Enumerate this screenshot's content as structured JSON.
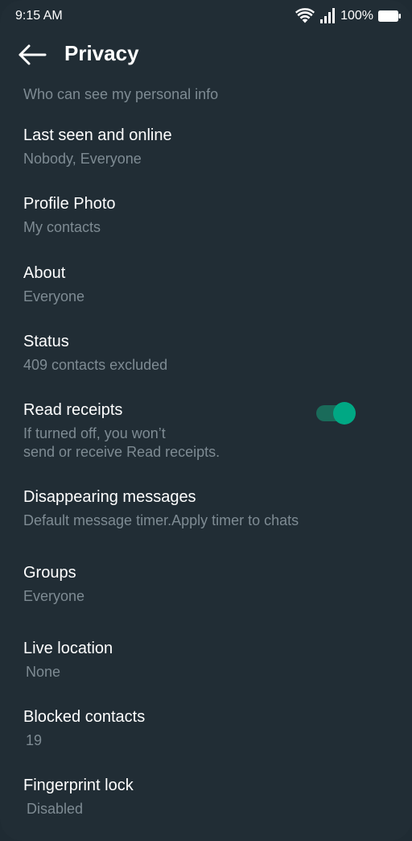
{
  "status_bar": {
    "time": "9:15 AM",
    "battery": "100%",
    "icons": [
      "wifi-icon",
      "signal-icon",
      "battery-icon"
    ]
  },
  "app_bar": {
    "title": "Privacy",
    "back_icon": "arrow-left-icon"
  },
  "section_header": "Who can see my personal info",
  "settings": [
    {
      "title": "Last seen and online",
      "subtitle": "Nobody, Everyone"
    },
    {
      "title": "Profile Photo",
      "subtitle": "My contacts"
    },
    {
      "title": "About",
      "subtitle": "Everyone"
    },
    {
      "title": "Status",
      "subtitle": "409 contacts excluded"
    },
    {
      "title": "Read receipts",
      "subtitle_line1": "If turned off, you won’t",
      "subtitle_line2": "send or receive Read receipts.",
      "toggle_on": true
    },
    {
      "title": "Disappearing messages",
      "subtitle": "Default message timer.Apply timer to chats"
    },
    {
      "title": "Groups",
      "subtitle": "Everyone"
    },
    {
      "title": "Live location",
      "subtitle": "None"
    },
    {
      "title": "Blocked contacts",
      "subtitle": "19"
    },
    {
      "title": "Fingerprint lock",
      "subtitle": "Disabled"
    }
  ],
  "colors": {
    "background": "#212d35",
    "title_text": "#ffffff",
    "secondary_text": "#7e8b93",
    "accent": "#00a884",
    "toggle_track": "#1a6b5a"
  }
}
